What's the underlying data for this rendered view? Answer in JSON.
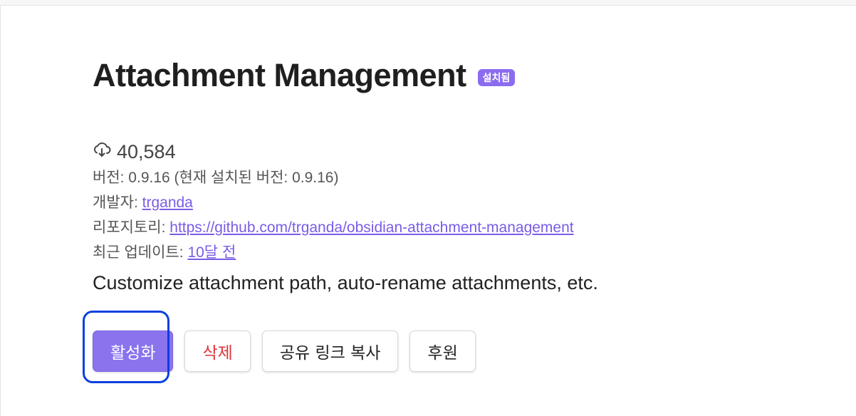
{
  "plugin": {
    "name": "Attachment Management",
    "badge": "설치됨",
    "downloads": "40,584",
    "version_line": "버전: 0.9.16 (현재 설치된 버전: 0.9.16)",
    "author_label": "개발자: ",
    "author": "trganda",
    "repo_label": "리포지토리: ",
    "repo_url": "https://github.com/trganda/obsidian-attachment-management",
    "updated_label": "최근 업데이트: ",
    "updated_value": "10달 전",
    "description": "Customize attachment path, auto-rename attachments, etc."
  },
  "buttons": {
    "enable": "활성화",
    "delete": "삭제",
    "copy_link": "공유 링크 복사",
    "donate": "후원"
  },
  "icons": {
    "download": "cloud-download-icon"
  }
}
